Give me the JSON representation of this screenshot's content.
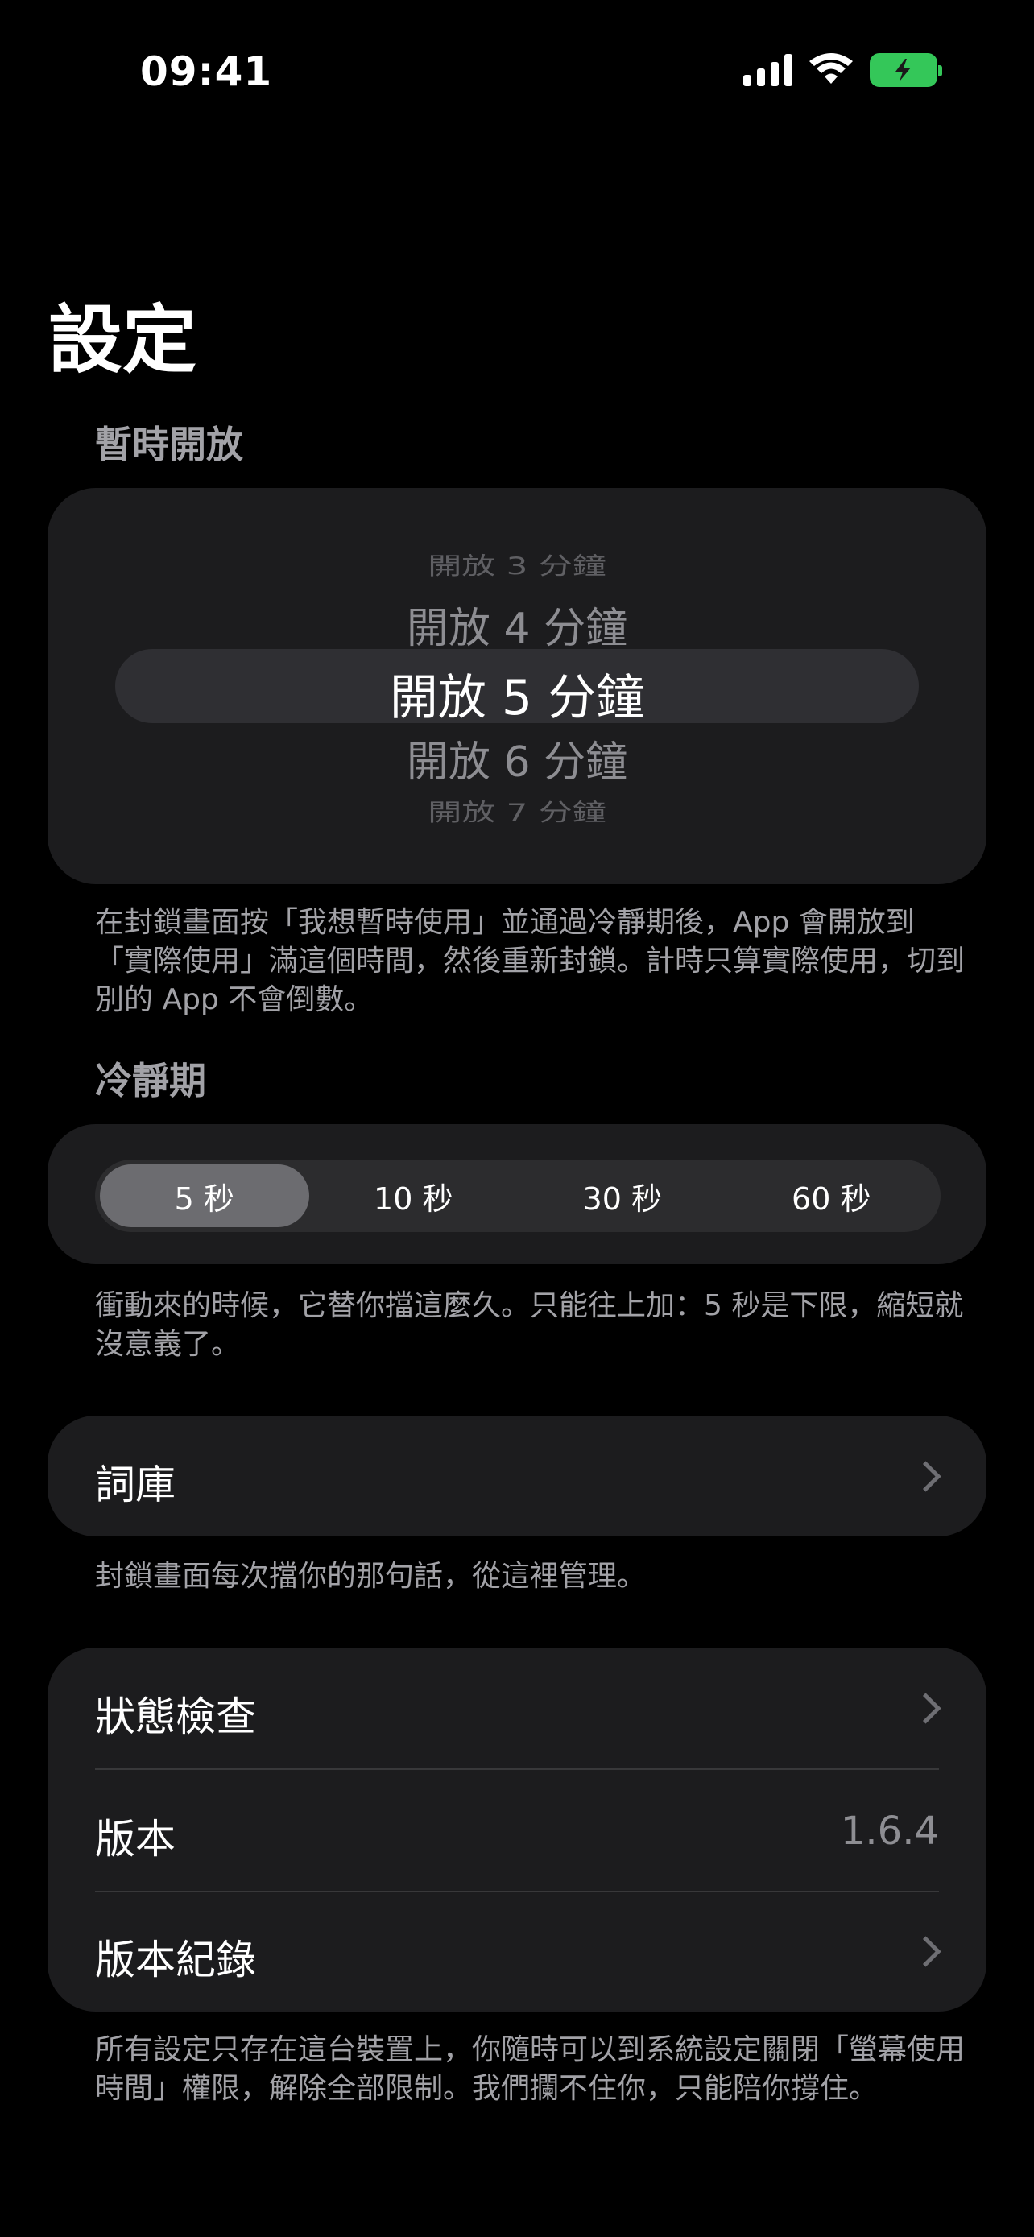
{
  "status_bar": {
    "time": "09:41",
    "icons": [
      "signal-icon",
      "wifi-icon",
      "battery-charging-icon"
    ],
    "battery_color": "#34c759"
  },
  "page": {
    "title": "設定"
  },
  "temporary_open": {
    "label": "暫時開放",
    "picker_options": [
      "開放 3 分鐘",
      "開放 4 分鐘",
      "開放 5 分鐘",
      "開放 6 分鐘",
      "開放 7 分鐘"
    ],
    "selected": "開放 5 分鐘",
    "footnote": "在封鎖畫面按「我想暫時使用」並通過冷靜期後，App 會開放到「實際使用」滿這個時間，然後重新封鎖。計時只算實際使用，切到別的 App 不會倒數。"
  },
  "cooldown": {
    "label": "冷靜期",
    "options": [
      "5 秒",
      "10 秒",
      "30 秒",
      "60 秒"
    ],
    "selected": "5 秒",
    "footnote": "衝動來的時候，它替你擋這麼久。只能往上加：5 秒是下限，縮短就沒意義了。"
  },
  "dictionary": {
    "label": "詞庫",
    "footnote": "封鎖畫面每次擋你的那句話，從這裡管理。"
  },
  "info": {
    "status_check": "狀態檢查",
    "version_label": "版本",
    "version_value": "1.6.4",
    "changelog": "版本紀錄",
    "footnote": "所有設定只存在這台裝置上，你隨時可以到系統設定關閉「螢幕使用時間」權限，解除全部限制。我們攔不住你，只能陪你撐住。"
  }
}
